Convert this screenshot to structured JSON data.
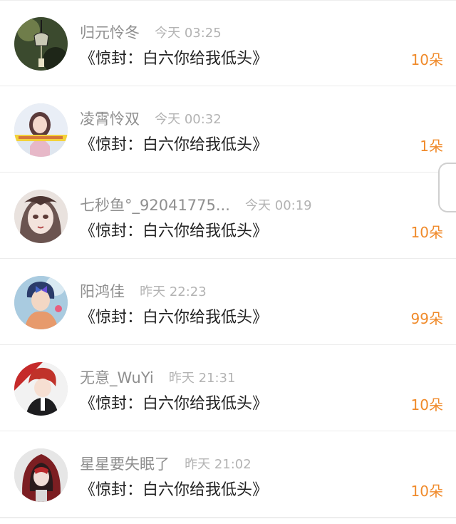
{
  "entries": [
    {
      "name": "归元怜冬",
      "time": "今天 03:25",
      "title": "《惊封：白六你给我低头》",
      "count": "10朵",
      "avatar_icon": "wind-chime-avatar"
    },
    {
      "name": "凌霄怜双",
      "time": "今天 00:32",
      "title": "《惊封：白六你给我低头》",
      "count": "1朵",
      "avatar_icon": "girl-banner-avatar"
    },
    {
      "name": "七秒鱼°_92041775...",
      "time": "今天 00:19",
      "title": "《惊封：白六你给我低头》",
      "count": "10朵",
      "avatar_icon": "anime-girl-avatar"
    },
    {
      "name": "阳鸿佳",
      "time": "昨天 22:23",
      "title": "《惊封：白六你给我低头》",
      "count": "99朵",
      "avatar_icon": "butterfly-boy-avatar"
    },
    {
      "name": "无意_WuYi",
      "time": "昨天 21:31",
      "title": "《惊封：白六你给我低头》",
      "count": "10朵",
      "avatar_icon": "red-hair-boy-avatar"
    },
    {
      "name": "星星要失眠了",
      "time": "昨天 21:02",
      "title": "《惊封：白六你给我低头》",
      "count": "10朵",
      "avatar_icon": "red-hood-avatar"
    }
  ],
  "colors": {
    "count": "#f08a2a",
    "name": "#8f8f8f",
    "time": "#b3b3b3",
    "title": "#222222"
  }
}
